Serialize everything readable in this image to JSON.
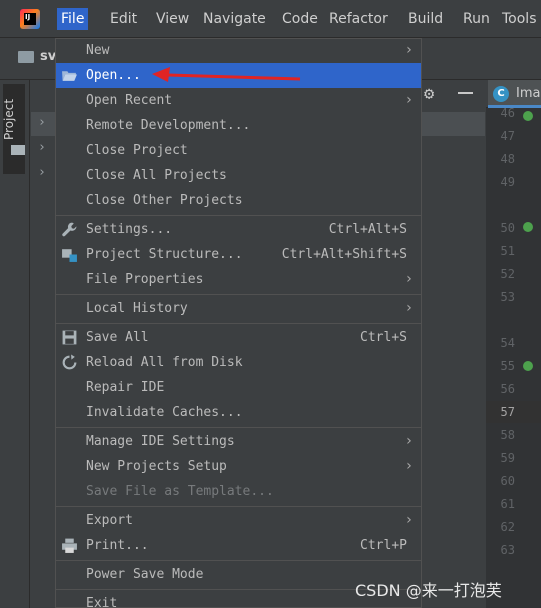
{
  "menubar": {
    "items": [
      "File",
      "Edit",
      "View",
      "Navigate",
      "Code",
      "Refactor",
      "Build",
      "Run",
      "Tools"
    ],
    "active": "File"
  },
  "toolbar": {
    "project_name": "sv"
  },
  "tool_window": {
    "project_tab_label": "Project"
  },
  "editor": {
    "tab_label": "Ima",
    "tab_icon_letter": "C",
    "line_numbers": [
      "46",
      "47",
      "48",
      "49",
      "50",
      "51",
      "52",
      "53",
      "54",
      "55",
      "56",
      "57",
      "58",
      "59",
      "60",
      "61",
      "62",
      "63"
    ],
    "current_line": "57"
  },
  "file_menu": {
    "items": [
      {
        "label": "New",
        "submenu": true
      },
      {
        "label": "Open...",
        "icon": "folder-open-icon",
        "highlighted": true
      },
      {
        "label": "Open Recent",
        "submenu": true
      },
      {
        "label": "Remote Development..."
      },
      {
        "label": "Close Project"
      },
      {
        "label": "Close All Projects"
      },
      {
        "label": "Close Other Projects"
      },
      {
        "label": "Settings...",
        "shortcut": "Ctrl+Alt+S",
        "icon": "wrench-icon"
      },
      {
        "label": "Project Structure...",
        "shortcut": "Ctrl+Alt+Shift+S",
        "icon": "project-structure-icon"
      },
      {
        "label": "File Properties",
        "submenu": true
      },
      {
        "label": "Local History",
        "submenu": true
      },
      {
        "label": "Save All",
        "shortcut": "Ctrl+S",
        "icon": "save-icon"
      },
      {
        "label": "Reload All from Disk",
        "icon": "reload-icon"
      },
      {
        "label": "Repair IDE"
      },
      {
        "label": "Invalidate Caches..."
      },
      {
        "label": "Manage IDE Settings",
        "submenu": true
      },
      {
        "label": "New Projects Setup",
        "submenu": true
      },
      {
        "label": "Save File as Template...",
        "disabled": true
      },
      {
        "label": "Export",
        "submenu": true
      },
      {
        "label": "Print...",
        "shortcut": "Ctrl+P",
        "icon": "print-icon"
      },
      {
        "label": "Power Save Mode"
      },
      {
        "label": "Exit"
      }
    ]
  },
  "colors": {
    "accent": "#2f65ca",
    "annotation_arrow": "#e02424",
    "menu_bg": "#3c3f41"
  },
  "watermark": "CSDN @来一打泡芙"
}
